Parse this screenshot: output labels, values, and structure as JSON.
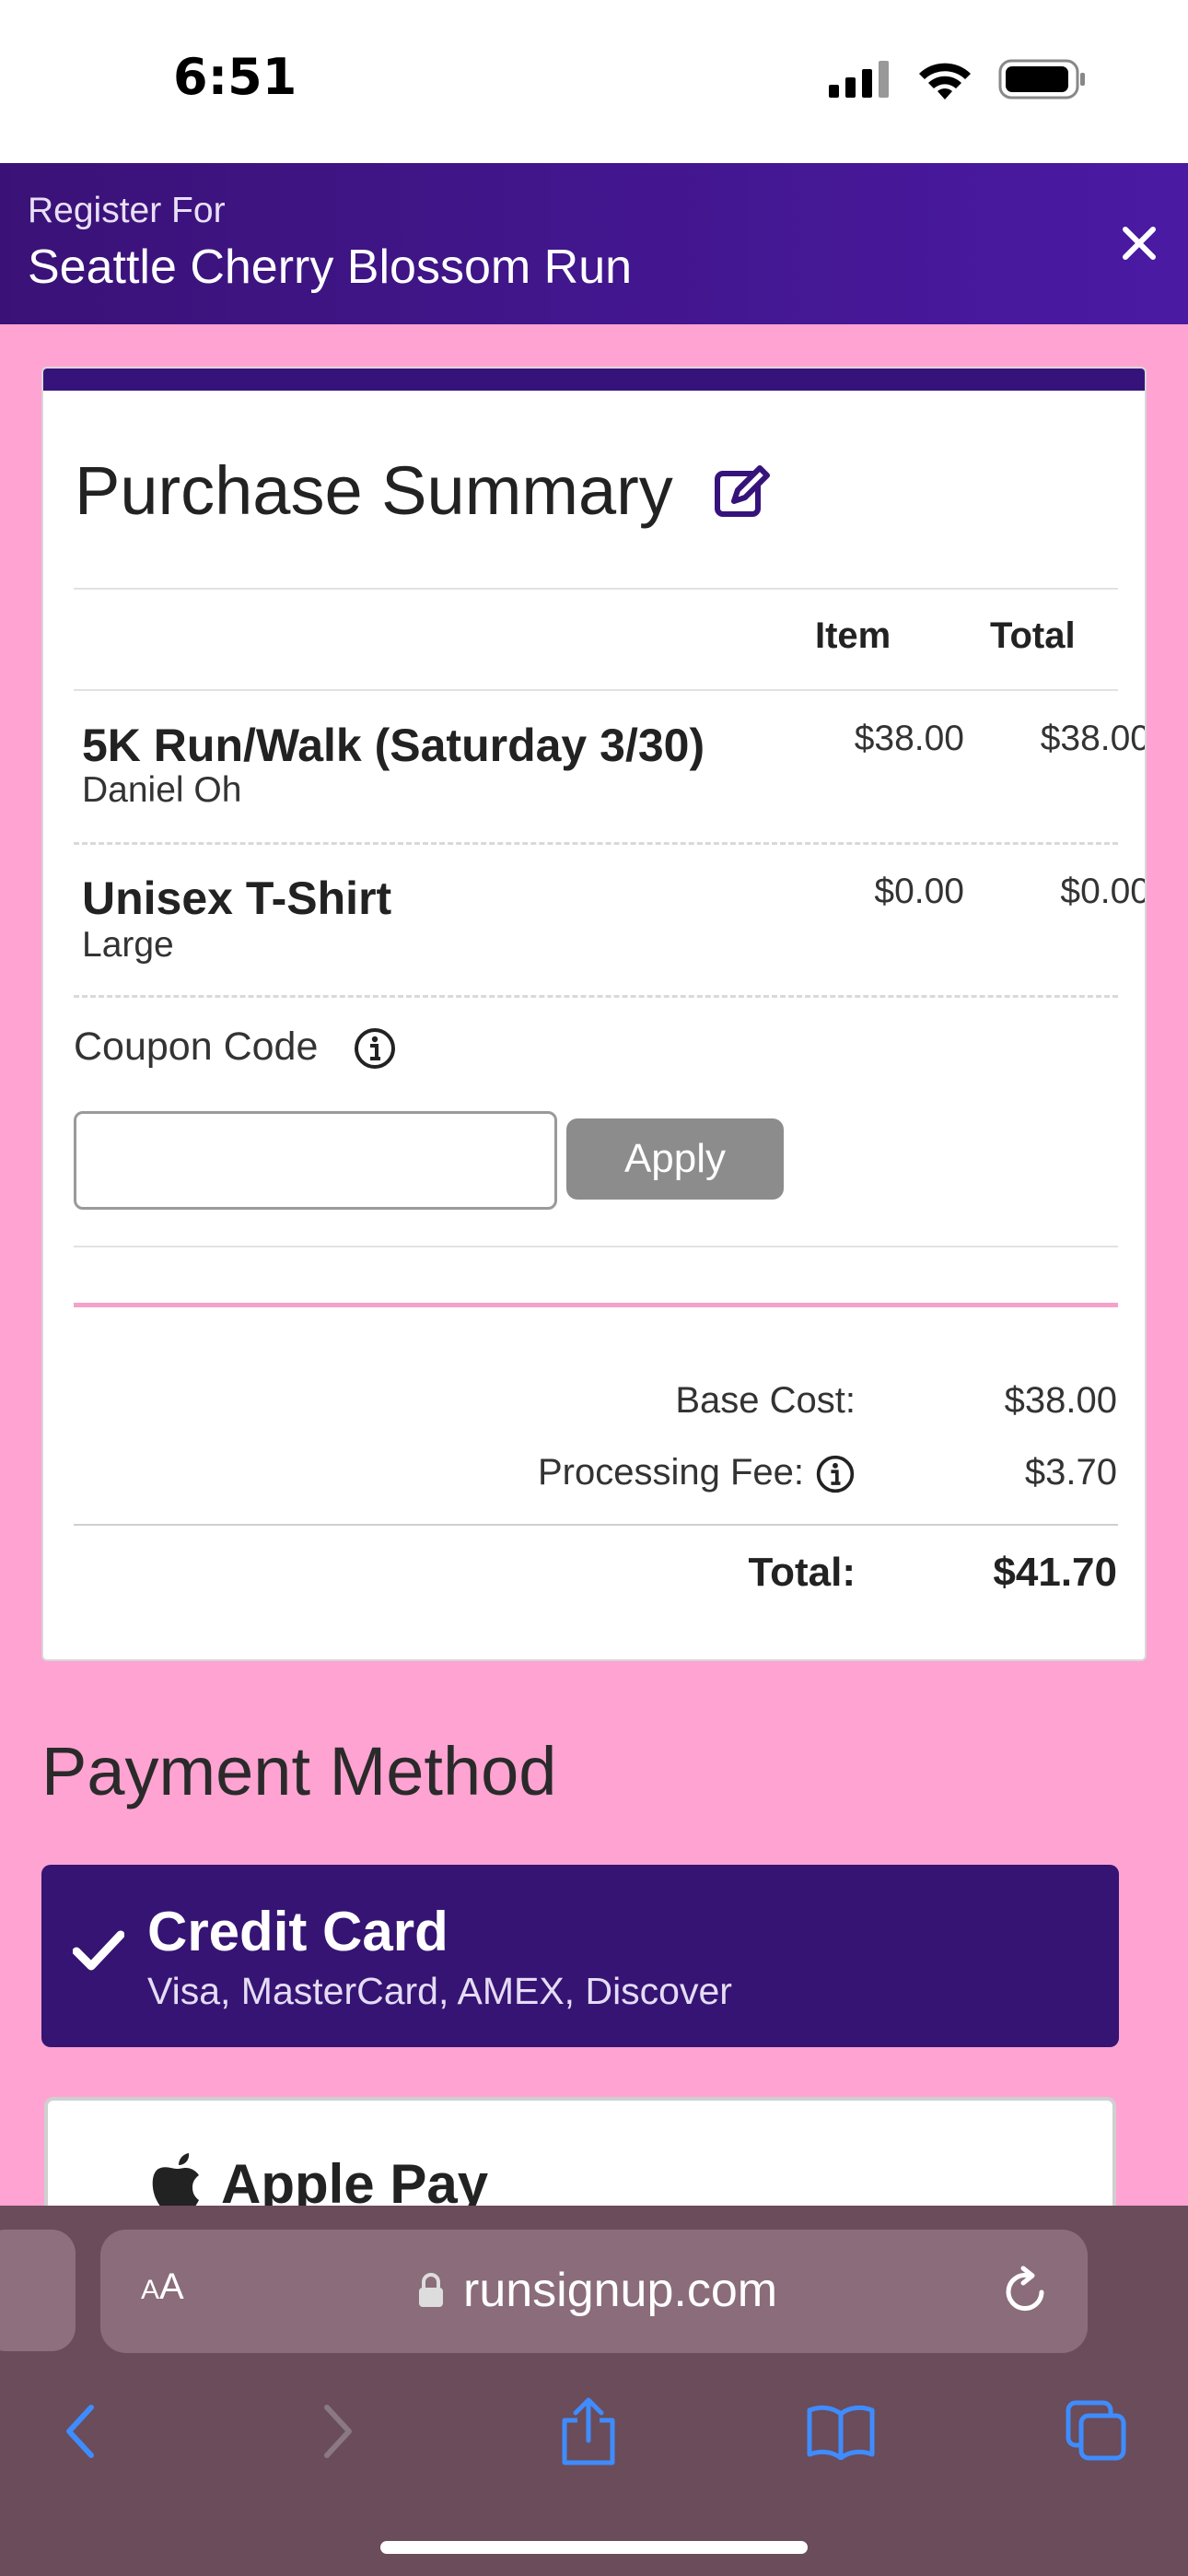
{
  "status_bar": {
    "time": "6:51"
  },
  "header": {
    "subtitle": "Register For",
    "title": "Seattle Cherry Blossom Run"
  },
  "summary": {
    "title": "Purchase Summary",
    "col_item": "Item",
    "col_total": "Total",
    "items": [
      {
        "name": "5K Run/Walk (Saturday 3/30)",
        "detail": "Daniel Oh",
        "item": "$38.00",
        "total": "$38.00"
      },
      {
        "name": "Unisex T-Shirt",
        "detail": "Large",
        "item": "$0.00",
        "total": "$0.00"
      }
    ],
    "coupon_label": "Coupon Code",
    "coupon_value": "",
    "apply_label": "Apply",
    "base_cost_label": "Base Cost:",
    "base_cost_value": "$38.00",
    "fee_label": "Processing Fee:",
    "fee_value": "$3.70",
    "total_label": "Total:",
    "total_value": "$41.70"
  },
  "payment": {
    "heading": "Payment Method",
    "credit_title": "Credit Card",
    "credit_sub": "Visa, MasterCard, AMEX, Discover",
    "apple_title": "Apple Pay"
  },
  "browser": {
    "aa_small": "A",
    "aa_large": "A",
    "url": "runsignup.com"
  },
  "colors": {
    "page_bg": "#ffa3d3",
    "header_purple": "#3a1277",
    "selected_purple": "#361473",
    "apply_gray": "#8c8c8c",
    "ios_blue": "#3f8cff"
  },
  "icons": [
    "close-icon",
    "edit-icon",
    "info-icon",
    "checkmark-icon",
    "apple-logo-icon",
    "lock-icon",
    "reload-icon",
    "back-icon",
    "forward-icon",
    "share-icon",
    "bookmarks-icon",
    "tabs-icon"
  ]
}
